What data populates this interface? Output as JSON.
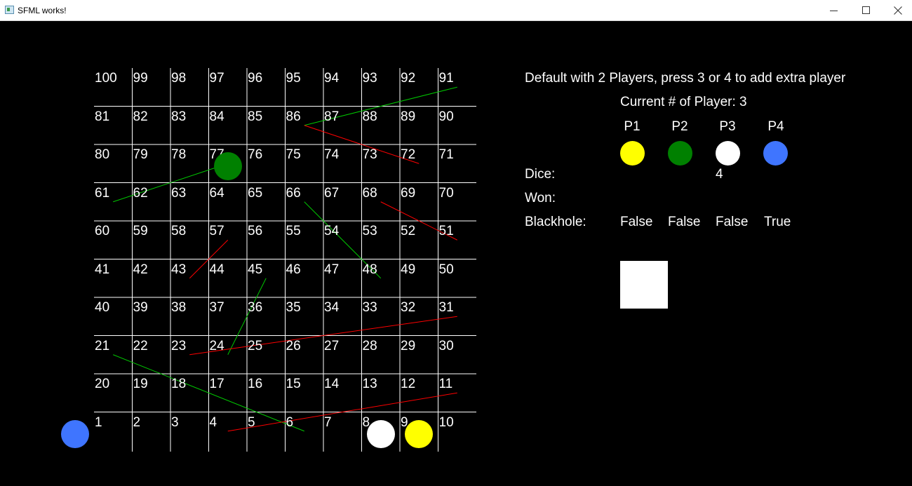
{
  "window": {
    "title": "SFML works!"
  },
  "colors": {
    "p1": "#ffff00",
    "p2": "#008000",
    "p3": "#ffffff",
    "p4": "#3f75ff",
    "snake": "#ff0000",
    "ladder": "#00c800",
    "grid": "#ffffff"
  },
  "board": {
    "rows": [
      [
        "100",
        "99",
        "98",
        "97",
        "96",
        "95",
        "94",
        "93",
        "92",
        "91"
      ],
      [
        "81",
        "82",
        "83",
        "84",
        "85",
        "86",
        "87",
        "88",
        "89",
        "90"
      ],
      [
        "80",
        "79",
        "78",
        "77",
        "76",
        "75",
        "74",
        "73",
        "72",
        "71"
      ],
      [
        "61",
        "62",
        "63",
        "64",
        "65",
        "66",
        "67",
        "68",
        "69",
        "70"
      ],
      [
        "60",
        "59",
        "58",
        "57",
        "56",
        "55",
        "54",
        "53",
        "52",
        "51"
      ],
      [
        "41",
        "42",
        "43",
        "44",
        "45",
        "46",
        "47",
        "48",
        "49",
        "50"
      ],
      [
        "40",
        "39",
        "38",
        "37",
        "36",
        "35",
        "34",
        "33",
        "32",
        "31"
      ],
      [
        "21",
        "22",
        "23",
        "24",
        "25",
        "26",
        "27",
        "28",
        "29",
        "30"
      ],
      [
        "20",
        "19",
        "18",
        "17",
        "16",
        "15",
        "14",
        "13",
        "12",
        "11"
      ],
      [
        "1",
        "2",
        "3",
        "4",
        "5",
        "6",
        "7",
        "8",
        "9",
        "10"
      ]
    ],
    "ladders": [
      {
        "from": 86,
        "to": 91
      },
      {
        "from": 61,
        "to": 77
      },
      {
        "from": 48,
        "to": 66
      },
      {
        "from": 24,
        "to": 45
      },
      {
        "from": 6,
        "to": 21
      }
    ],
    "snakes": [
      {
        "from": 72,
        "to": 86
      },
      {
        "from": 51,
        "to": 68
      },
      {
        "from": 43,
        "to": 57
      },
      {
        "from": 31,
        "to": 23
      },
      {
        "from": 11,
        "to": 4
      }
    ],
    "tokens": [
      {
        "player": "P4",
        "position": 0
      },
      {
        "player": "P2",
        "position": 77
      },
      {
        "player": "P3",
        "position": 8
      },
      {
        "player": "P1",
        "position": 9
      }
    ]
  },
  "panel": {
    "instructions": "Default with 2 Players, press 3 or 4 to add extra player",
    "current_players": "Current # of Player: 3",
    "players": [
      {
        "label": "P1",
        "color": "#ffff00",
        "blackhole": "False"
      },
      {
        "label": "P2",
        "color": "#008000",
        "blackhole": "False"
      },
      {
        "label": "P3",
        "color": "#ffffff",
        "blackhole": "False"
      },
      {
        "label": "P4",
        "color": "#3f75ff",
        "blackhole": "True"
      }
    ],
    "dice_label": "Dice:",
    "dice_value": "4",
    "won_label": "Won:",
    "blackhole_label": "Blackhole:"
  }
}
